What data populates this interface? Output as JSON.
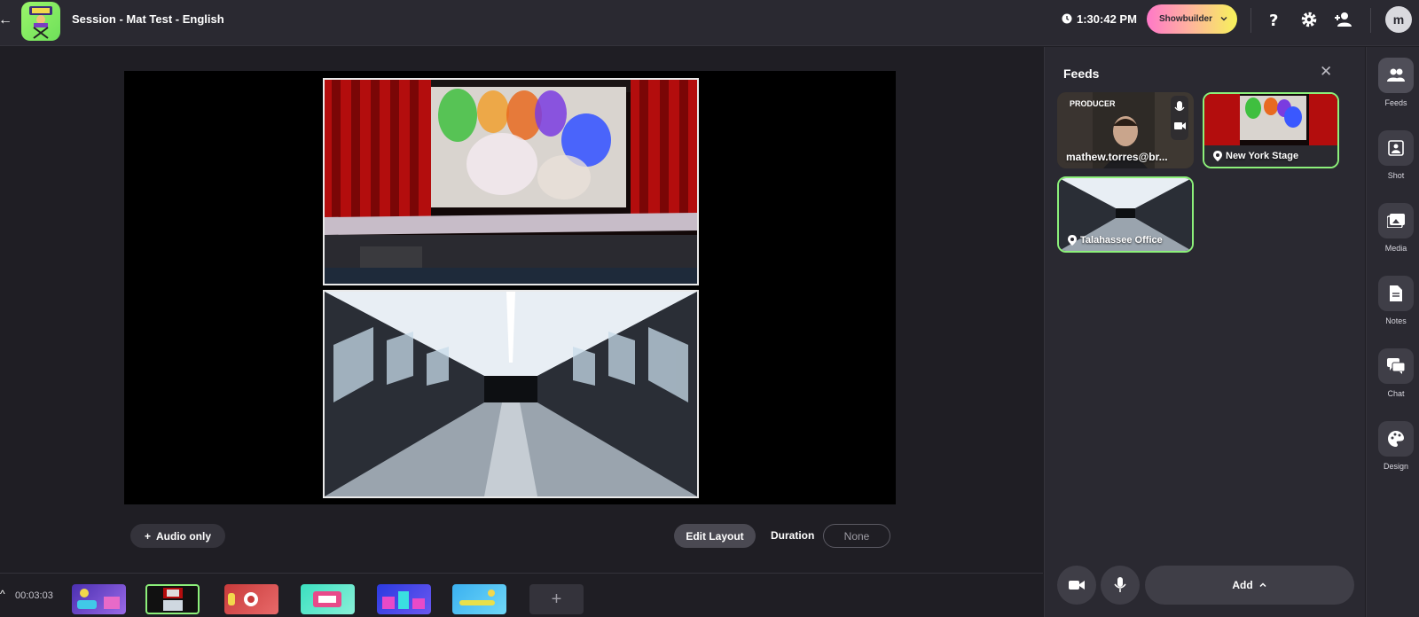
{
  "header": {
    "session_title": "Session - Mat Test - English",
    "clock": "1:30:42 PM",
    "showbuilder_label": "Showbuilder",
    "avatar_initial": "m"
  },
  "stage": {
    "feeds": [
      "New York Stage",
      "Talahassee Office"
    ]
  },
  "controls": {
    "audio_only_label": "Audio only",
    "edit_layout_label": "Edit Layout",
    "duration_label": "Duration",
    "duration_value": "None"
  },
  "scene_strip": {
    "elapsed": "00:03:03",
    "add_label": "+"
  },
  "feeds_panel": {
    "title": "Feeds",
    "cards": [
      {
        "label": "mathew.torres@br...",
        "badge": "PRODUCER"
      },
      {
        "label": "New York Stage"
      },
      {
        "label": "Talahassee Office"
      }
    ],
    "add_label": "Add"
  },
  "right_rail": {
    "items": [
      {
        "label": "Feeds",
        "icon": "users-icon"
      },
      {
        "label": "Shot",
        "icon": "shot-icon"
      },
      {
        "label": "Media",
        "icon": "image-icon"
      },
      {
        "label": "Notes",
        "icon": "document-icon"
      },
      {
        "label": "Chat",
        "icon": "chat-icon"
      },
      {
        "label": "Design",
        "icon": "palette-icon"
      }
    ]
  },
  "colors": {
    "accent_green": "#8cf07a",
    "panel_bg": "#2a2931",
    "page_bg": "#1f1e24"
  }
}
